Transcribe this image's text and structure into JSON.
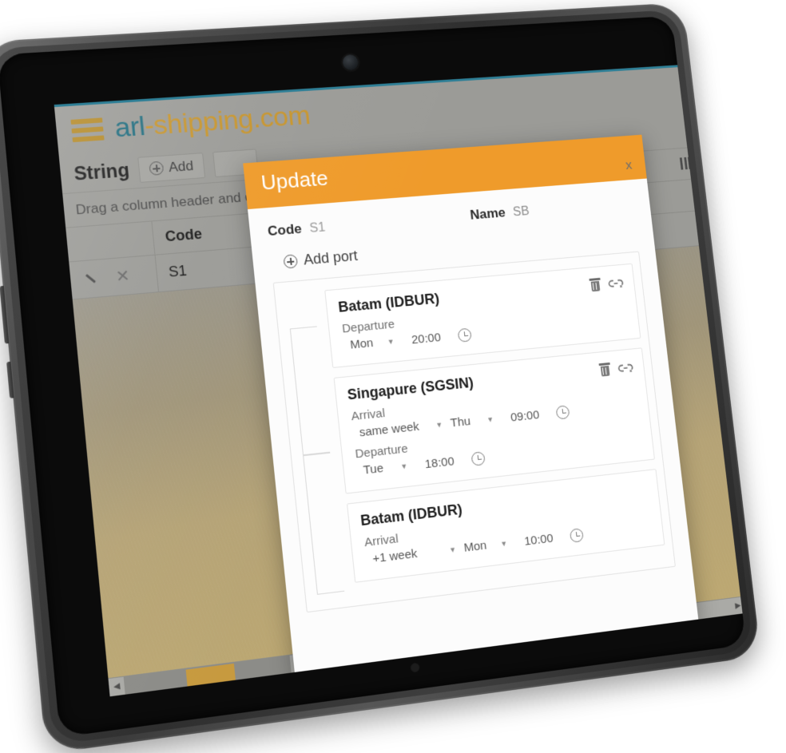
{
  "site": {
    "brand_primary": "arl",
    "brand_secondary": "-shipping.com",
    "menu_icon": "hamburger-icon",
    "accent_color": "#c8952c",
    "teal_color": "#1f6d7f"
  },
  "toolbar": {
    "page_title": "String",
    "add_label": "Add"
  },
  "grid": {
    "hint": "Drag a column header and drop it here to group by that column",
    "columns": [
      "",
      "Code"
    ],
    "rows": [
      {
        "edit_icon": "pencil-icon",
        "delete_icon": "close-icon",
        "code": "S1"
      }
    ],
    "column_chooser_icon": "columns-icon"
  },
  "dialog": {
    "title": "Update",
    "close_label": "x",
    "code_label": "Code",
    "code_value": "S1",
    "name_label": "Name",
    "name_value": "SB",
    "add_port_label": "Add port",
    "ports": [
      {
        "name": "Batam (IDBUR)",
        "delete_icon": "trash-icon",
        "link_icon": "link-icon",
        "schedules": [
          {
            "label": "Departure",
            "week": null,
            "day": "Mon",
            "time": "20:00",
            "clock_icon": "clock-icon"
          }
        ]
      },
      {
        "name": "Singapure (SGSIN)",
        "delete_icon": "trash-icon",
        "link_icon": "link-icon",
        "schedules": [
          {
            "label": "Arrival",
            "week": "same week",
            "day": "Thu",
            "time": "09:00",
            "clock_icon": "clock-icon"
          },
          {
            "label": "Departure",
            "week": null,
            "day": "Tue",
            "time": "18:00",
            "clock_icon": "clock-icon"
          }
        ]
      },
      {
        "name": "Batam (IDBUR)",
        "delete_icon": null,
        "link_icon": null,
        "schedules": [
          {
            "label": "Arrival",
            "week": "+1 week",
            "day": "Mon",
            "time": "10:00",
            "clock_icon": "clock-icon"
          }
        ]
      }
    ]
  },
  "scrollbars": {
    "h_left_arrow": "◀",
    "h_right_arrow": "▶",
    "v_down_arrow": "▼"
  }
}
